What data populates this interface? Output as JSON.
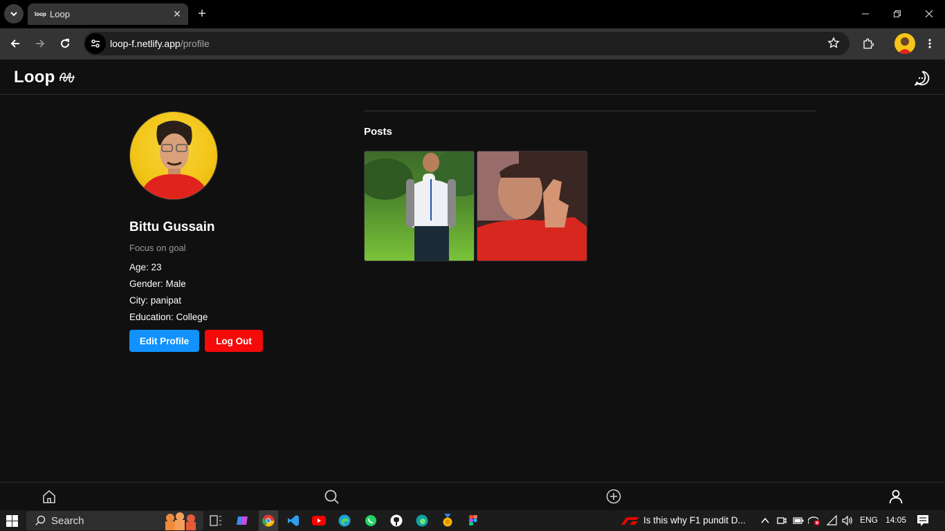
{
  "browser": {
    "tab_title": "Loop",
    "tab_favicon_text": "loop",
    "url_host": "loop-f.netlify.app",
    "url_path": "/profile"
  },
  "app": {
    "logo": "Loop"
  },
  "profile": {
    "name": "Bittu Gussain",
    "bio": "Focus on goal",
    "age": "Age: 23",
    "gender": "Gender: Male",
    "city": "City: panipat",
    "education": "Education: College",
    "edit_label": "Edit Profile",
    "logout_label": "Log Out"
  },
  "posts": {
    "title": "Posts"
  },
  "taskbar": {
    "search_label": "Search",
    "news": "Is this why F1 pundit D...",
    "lang": "ENG",
    "time": "14:05"
  },
  "colors": {
    "background": "#111011",
    "edit_button": "#1192ff",
    "logout_button": "#f50a0a"
  }
}
